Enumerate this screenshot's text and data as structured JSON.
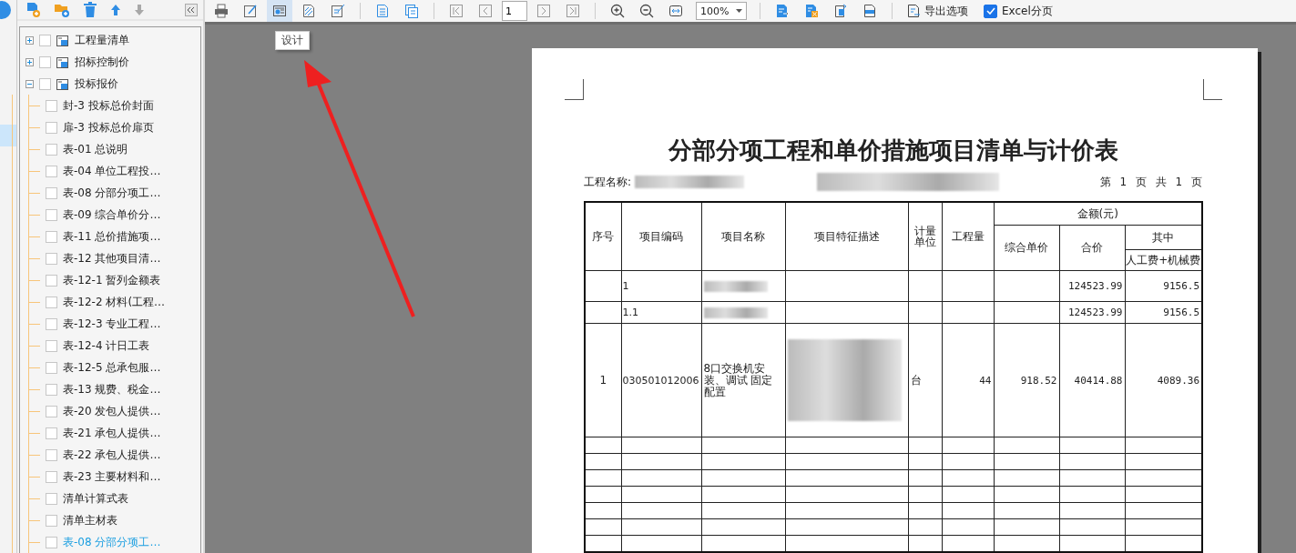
{
  "tree_toolbar": {
    "move_down_button": {
      "disabled": true
    }
  },
  "tree": [
    {
      "label": "工程量清单",
      "expanded": false,
      "checked": false
    },
    {
      "label": "招标控制价",
      "expanded": false,
      "checked": false
    },
    {
      "label": "投标报价",
      "expanded": true,
      "checked": false,
      "children": [
        {
          "label": "封-3 投标总价封面",
          "checked": false,
          "selected": false
        },
        {
          "label": "扉-3 投标总价扉页",
          "checked": false,
          "selected": false
        },
        {
          "label": "表-01 总说明",
          "checked": false,
          "selected": false
        },
        {
          "label": "表-04 单位工程投…",
          "checked": false,
          "selected": false
        },
        {
          "label": "表-08 分部分项工…",
          "checked": false,
          "selected": false
        },
        {
          "label": "表-09 综合单价分…",
          "checked": false,
          "selected": false
        },
        {
          "label": "表-11 总价措施项…",
          "checked": false,
          "selected": false
        },
        {
          "label": "表-12 其他项目清…",
          "checked": false,
          "selected": false
        },
        {
          "label": "表-12-1 暂列金额表",
          "checked": false,
          "selected": false
        },
        {
          "label": "表-12-2 材料(工程…",
          "checked": false,
          "selected": false
        },
        {
          "label": "表-12-3 专业工程…",
          "checked": false,
          "selected": false
        },
        {
          "label": "表-12-4 计日工表",
          "checked": false,
          "selected": false
        },
        {
          "label": "表-12-5 总承包服…",
          "checked": false,
          "selected": false
        },
        {
          "label": "表-13 规费、税金…",
          "checked": false,
          "selected": false
        },
        {
          "label": "表-20 发包人提供…",
          "checked": false,
          "selected": false
        },
        {
          "label": "表-21 承包人提供…",
          "checked": false,
          "selected": false
        },
        {
          "label": "表-22 承包人提供…",
          "checked": false,
          "selected": false
        },
        {
          "label": "表-23 主要材料和…",
          "checked": false,
          "selected": false
        },
        {
          "label": "清单计算式表",
          "checked": false,
          "selected": false
        },
        {
          "label": "清单主材表",
          "checked": false,
          "selected": false
        },
        {
          "label": "表-08 分部分项工…",
          "checked": false,
          "selected": true
        }
      ]
    }
  ],
  "toolbar": {
    "design_button": {
      "selected": true
    },
    "page_input": "1",
    "zoom_select": "100%",
    "export_options": "导出选项",
    "excel_paging": {
      "label": "Excel分页",
      "checked": true
    }
  },
  "tooltip": "设计",
  "report": {
    "title": "分部分项工程和单价措施项目清单与计价表",
    "project_label": "工程名称:",
    "project_redacted": true,
    "page_info": "第 1 页 共 1 页",
    "headers": {
      "no": "序号",
      "code": "项目编码",
      "name": "项目名称",
      "description": "项目特征描述",
      "unit": "计量单位",
      "quantity": "工程量",
      "amount": "金额(元)",
      "unit_price": "综合单价",
      "total": "合价",
      "of_which": "其中",
      "labor_machine": "人工费+机械费"
    },
    "rows": [
      {
        "kind": "item",
        "code": "1",
        "name_redacted": true,
        "total": "124523.99",
        "labor_machine": "9156.5"
      },
      {
        "kind": "item",
        "code": "1.1",
        "name_redacted": true,
        "total": "124523.99",
        "labor_machine": "9156.5"
      },
      {
        "kind": "item",
        "no": "1",
        "code": "030501012006",
        "name": "8口交换机安装、调试 固定配置",
        "description_redacted": true,
        "unit": "台",
        "quantity": "44",
        "unit_price": "918.52",
        "total": "40414.88",
        "labor_machine": "4089.36"
      },
      {
        "kind": "blank"
      },
      {
        "kind": "blank"
      },
      {
        "kind": "blank"
      },
      {
        "kind": "blank"
      },
      {
        "kind": "blank"
      },
      {
        "kind": "blank"
      },
      {
        "kind": "blank"
      }
    ]
  }
}
